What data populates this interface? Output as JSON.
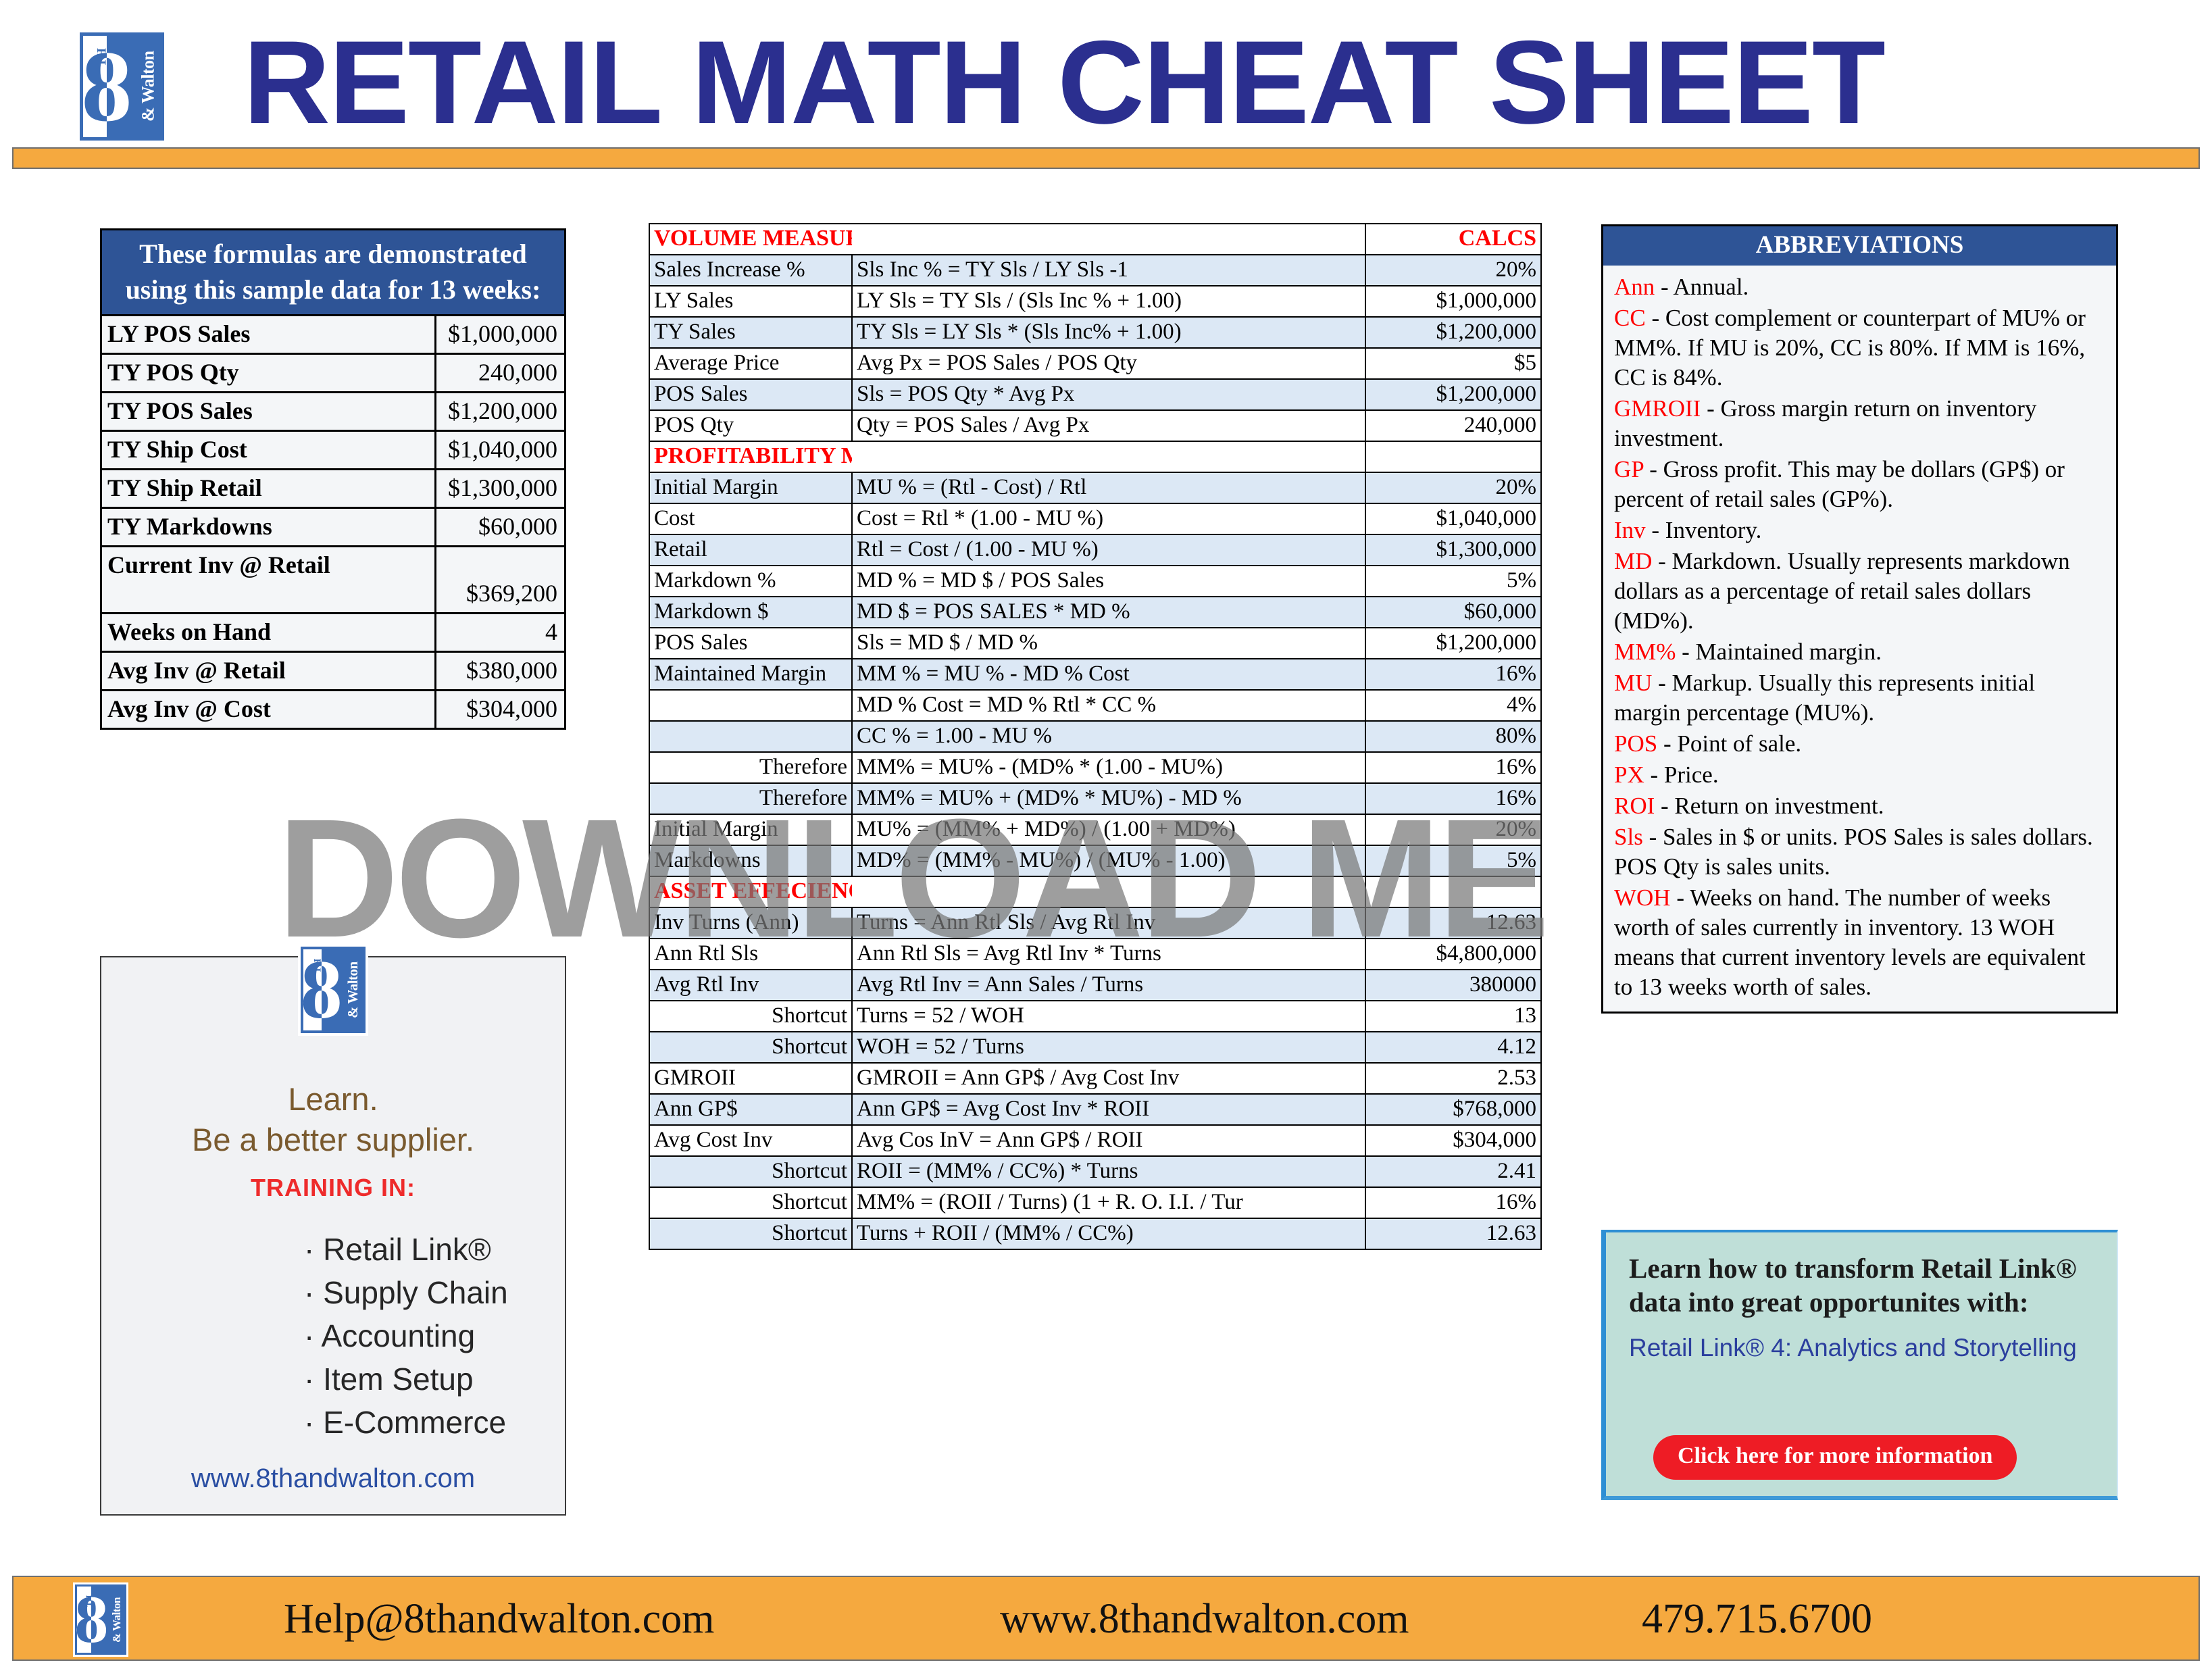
{
  "header": {
    "title": "RETAIL MATH CHEAT SHEET",
    "logo_eight": "8",
    "logo_th": "TH",
    "logo_walton": "& Walton"
  },
  "watermark": {
    "text": "DOWNLOAD ME"
  },
  "sample_panel": {
    "heading": "These formulas are demonstrated using this sample data for 13 weeks:",
    "rows": [
      {
        "label": "LY POS Sales",
        "value": "$1,000,000"
      },
      {
        "label": "TY POS Qty",
        "value": "240,000"
      },
      {
        "label": "TY POS Sales",
        "value": "$1,200,000"
      },
      {
        "label": "TY Ship Cost",
        "value": "$1,040,000"
      },
      {
        "label": "TY Ship Retail",
        "value": "$1,300,000"
      },
      {
        "label": "TY Markdowns",
        "value": "$60,000"
      },
      {
        "label": "Current Inv @ Retail",
        "value": "$369,200"
      },
      {
        "label": "Weeks on Hand",
        "value": "4"
      },
      {
        "label": "Avg Inv @ Retail",
        "value": "$380,000"
      },
      {
        "label": "Avg Inv @ Cost",
        "value": "$304,000"
      }
    ]
  },
  "left_promo": {
    "learn_line1": "Learn.",
    "learn_line2": "Be a better supplier.",
    "training_in": "TRAINING IN:",
    "items": [
      "· Retail Link®",
      "· Supply Chain",
      "· Accounting",
      "· Item Setup",
      "· E-Commerce"
    ],
    "url": "www.8thandwalton.com"
  },
  "formula_table": {
    "calcs_header": "CALCS",
    "sections": [
      {
        "title": "VOLUME MEASURES",
        "rows": [
          {
            "label": "Sales Increase %",
            "formula": "Sls Inc % = TY Sls / LY Sls -1",
            "calc": "20%"
          },
          {
            "label": "LY Sales",
            "formula": "LY Sls = TY Sls / (Sls Inc % + 1.00)",
            "calc": "$1,000,000"
          },
          {
            "label": "TY Sales",
            "formula": "TY Sls = LY Sls * (Sls Inc% + 1.00)",
            "calc": "$1,200,000"
          },
          {
            "label": "Average Price",
            "formula": "Avg Px = POS Sales / POS Qty",
            "calc": "$5"
          },
          {
            "label": "POS Sales",
            "formula": "Sls = POS Qty * Avg Px",
            "calc": "$1,200,000"
          },
          {
            "label": "POS Qty",
            "formula": "Qty = POS Sales / Avg Px",
            "calc": "240,000"
          }
        ]
      },
      {
        "title": "PROFITABILITY MEASURES",
        "rows": [
          {
            "label": "Initial Margin",
            "formula": "MU % = (Rtl - Cost) / Rtl",
            "calc": "20%"
          },
          {
            "label": "Cost",
            "formula": "Cost = Rtl * (1.00 - MU %)",
            "calc": "$1,040,000"
          },
          {
            "label": "Retail",
            "formula": "Rtl = Cost / (1.00 - MU %)",
            "calc": "$1,300,000"
          },
          {
            "label": "Markdown %",
            "formula": "MD % = MD $ / POS Sales",
            "calc": "5%"
          },
          {
            "label": "Markdown $",
            "formula": "MD $ = POS SALES * MD %",
            "calc": "$60,000"
          },
          {
            "label": "POS Sales",
            "formula": "Sls = MD $ / MD %",
            "calc": "$1,200,000"
          },
          {
            "label": "Maintained Margin",
            "formula": "MM % = MU % - MD % Cost",
            "calc": "16%"
          },
          {
            "label": "",
            "formula": "MD % Cost = MD % Rtl * CC %",
            "calc": "4%"
          },
          {
            "label": "",
            "formula": "CC % = 1.00 - MU %",
            "calc": "80%"
          },
          {
            "label": "Therefore",
            "label_align": "right",
            "formula": "MM% = MU% - (MD% * (1.00 - MU%)",
            "calc": "16%"
          },
          {
            "label": "Therefore",
            "label_align": "right",
            "formula": "MM% = MU% + (MD% * MU%) - MD %",
            "calc": "16%"
          },
          {
            "label": "Initial Margin",
            "formula": "MU% = (MM% + MD%) / (1.00 + MD%)",
            "calc": "20%"
          },
          {
            "label": "Markdowns",
            "formula": "MD% = (MM% - MU%) / (MU% - 1.00)",
            "calc": "5%"
          }
        ]
      },
      {
        "title": "ASSET EFFECIENCY MEASURES",
        "rows": [
          {
            "label": "Inv Turns (Ann)",
            "formula": "Turns = Ann Rtl Sls / Avg Rtl Inv",
            "calc": "12.63"
          },
          {
            "label": "Ann Rtl Sls",
            "formula": "Ann Rtl Sls = Avg Rtl Inv * Turns",
            "calc": "$4,800,000"
          },
          {
            "label": "Avg Rtl Inv",
            "formula": "Avg Rtl Inv = Ann Sales / Turns",
            "calc": "380000"
          },
          {
            "label": "Shortcut",
            "label_align": "right",
            "formula": "Turns = 52 / WOH",
            "calc": "13"
          },
          {
            "label": "Shortcut",
            "label_align": "right",
            "formula": "WOH = 52 / Turns",
            "calc": "4.12"
          },
          {
            "label": "GMROII",
            "formula": "GMROII = Ann GP$ / Avg Cost Inv",
            "calc": "2.53"
          },
          {
            "label": "Ann GP$",
            "formula": "Ann GP$ = Avg Cost Inv * ROII",
            "calc": "$768,000"
          },
          {
            "label": "Avg Cost Inv",
            "formula": "Avg Cos InV = Ann GP$ / ROII",
            "calc": "$304,000"
          },
          {
            "label": "Shortcut",
            "label_align": "right",
            "formula": "ROII = (MM% / CC%) * Turns",
            "calc": "2.41"
          },
          {
            "label": "Shortcut",
            "label_align": "right",
            "formula": "MM% = (ROII / Turns) (1 + R. O. I.I. / Tur",
            "calc": "16%"
          },
          {
            "label": "Shortcut",
            "label_align": "right",
            "formula": "Turns + ROII / (MM% / CC%)",
            "calc": "12.63"
          }
        ]
      }
    ]
  },
  "abbreviations": {
    "heading": "ABBREVIATIONS",
    "entries": [
      {
        "key": "Ann",
        "text": " - Annual."
      },
      {
        "key": "CC",
        "text": " - Cost complement or counterpart of MU% or MM%. If MU is 20%, CC is 80%. If MM is 16%, CC is 84%."
      },
      {
        "key": "GMROII",
        "text": " - Gross margin return on inventory investment."
      },
      {
        "key": "GP",
        "text": " - Gross profit. This may be dollars (GP$) or percent of retail sales (GP%)."
      },
      {
        "key": "Inv",
        "text": " - Inventory."
      },
      {
        "key": "MD",
        "text": " - Markdown. Usually represents markdown dollars as a percentage of retail sales dollars (MD%)."
      },
      {
        "key": "MM%",
        "text": " - Maintained margin."
      },
      {
        "key": "MU",
        "text": " - Markup. Usually this represents initial margin percentage (MU%)."
      },
      {
        "key": "POS",
        "text": " - Point of sale."
      },
      {
        "key": "PX",
        "text": " - Price."
      },
      {
        "key": "ROI",
        "text": " - Return on investment."
      },
      {
        "key": "Sls",
        "text": " - Sales in $ or units. POS Sales is sales dollars. POS Qty is sales units."
      },
      {
        "key": "WOH",
        "text": " - Weeks on hand. The number of weeks worth of sales currently in inventory. 13 WOH means that current inventory levels are equivalent to 13 weeks worth of sales."
      }
    ]
  },
  "teal_promo": {
    "title": "Learn how to transform Retail Link® data into great opportunites with:",
    "subtitle": "Retail Link® 4: Analytics and Storytelling",
    "button": "Click here for more information"
  },
  "footer": {
    "email": "Help@8thandwalton.com",
    "web": "www.8thandwalton.com",
    "phone": "479.715.6700"
  },
  "colors": {
    "brand_blue": "#2b2f8f",
    "panel_blue": "#2e5496",
    "orange": "#f5a93f",
    "red": "#ff0000",
    "row_alt": "#dce8f5",
    "teal": "#bfdfd8",
    "button_red": "#ee1c25"
  }
}
